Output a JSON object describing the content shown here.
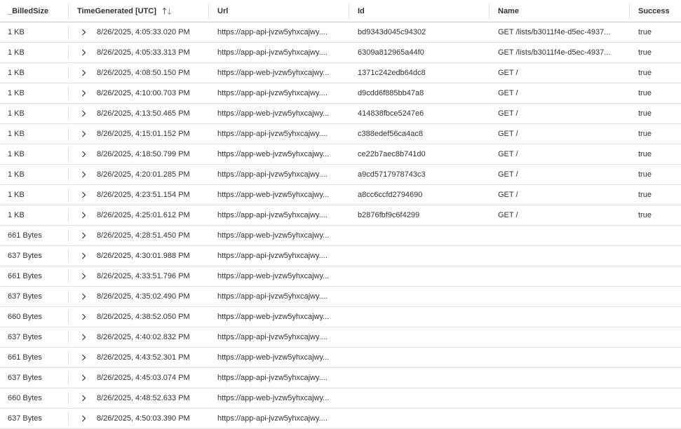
{
  "columns": [
    "_BilledSize",
    "TimeGenerated [UTC]",
    "Url",
    "Id",
    "Name",
    "Success"
  ],
  "rows": [
    {
      "size": "1 KB",
      "time": "8/26/2025, 4:05:33.020 PM",
      "url": "https://app-api-jvzw5yhxcajwy....",
      "id": "bd9343d045c94302",
      "name": "GET /lists/b3011f4e-d5ec-4937...",
      "success": "true"
    },
    {
      "size": "1 KB",
      "time": "8/26/2025, 4:05:33.313 PM",
      "url": "https://app-api-jvzw5yhxcajwy....",
      "id": "6309a812965a44f0",
      "name": "GET /lists/b3011f4e-d5ec-4937...",
      "success": "true"
    },
    {
      "size": "1 KB",
      "time": "8/26/2025, 4:08:50.150 PM",
      "url": "https://app-web-jvzw5yhxcajwy...",
      "id": "1371c242edb64dc8",
      "name": "GET /",
      "success": "true"
    },
    {
      "size": "1 KB",
      "time": "8/26/2025, 4:10:00.703 PM",
      "url": "https://app-api-jvzw5yhxcajwy....",
      "id": "d9cdd6f885bb47a8",
      "name": "GET /",
      "success": "true"
    },
    {
      "size": "1 KB",
      "time": "8/26/2025, 4:13:50.465 PM",
      "url": "https://app-web-jvzw5yhxcajwy...",
      "id": "414838fbce5247e6",
      "name": "GET /",
      "success": "true"
    },
    {
      "size": "1 KB",
      "time": "8/26/2025, 4:15:01.152 PM",
      "url": "https://app-api-jvzw5yhxcajwy....",
      "id": "c388edef56ca4ac8",
      "name": "GET /",
      "success": "true"
    },
    {
      "size": "1 KB",
      "time": "8/26/2025, 4:18:50.799 PM",
      "url": "https://app-web-jvzw5yhxcajwy...",
      "id": "ce22b7aec8b741d0",
      "name": "GET /",
      "success": "true"
    },
    {
      "size": "1 KB",
      "time": "8/26/2025, 4:20:01.285 PM",
      "url": "https://app-api-jvzw5yhxcajwy....",
      "id": "a9cd5717978743c3",
      "name": "GET /",
      "success": "true"
    },
    {
      "size": "1 KB",
      "time": "8/26/2025, 4:23:51.154 PM",
      "url": "https://app-web-jvzw5yhxcajwy...",
      "id": "a8cc6ccfd2794690",
      "name": "GET /",
      "success": "true"
    },
    {
      "size": "1 KB",
      "time": "8/26/2025, 4:25:01.612 PM",
      "url": "https://app-api-jvzw5yhxcajwy....",
      "id": "b2876fbf9c6f4299",
      "name": "GET /",
      "success": "true"
    },
    {
      "size": "661 Bytes",
      "time": "8/26/2025, 4:28:51.450 PM",
      "url": "https://app-web-jvzw5yhxcajwy...",
      "id": "",
      "name": "",
      "success": ""
    },
    {
      "size": "637 Bytes",
      "time": "8/26/2025, 4:30:01.988 PM",
      "url": "https://app-api-jvzw5yhxcajwy....",
      "id": "",
      "name": "",
      "success": ""
    },
    {
      "size": "661 Bytes",
      "time": "8/26/2025, 4:33:51.796 PM",
      "url": "https://app-web-jvzw5yhxcajwy...",
      "id": "",
      "name": "",
      "success": ""
    },
    {
      "size": "637 Bytes",
      "time": "8/26/2025, 4:35:02.490 PM",
      "url": "https://app-api-jvzw5yhxcajwy....",
      "id": "",
      "name": "",
      "success": ""
    },
    {
      "size": "660 Bytes",
      "time": "8/26/2025, 4:38:52.050 PM",
      "url": "https://app-web-jvzw5yhxcajwy...",
      "id": "",
      "name": "",
      "success": ""
    },
    {
      "size": "637 Bytes",
      "time": "8/26/2025, 4:40:02.832 PM",
      "url": "https://app-api-jvzw5yhxcajwy....",
      "id": "",
      "name": "",
      "success": ""
    },
    {
      "size": "661 Bytes",
      "time": "8/26/2025, 4:43:52.301 PM",
      "url": "https://app-web-jvzw5yhxcajwy...",
      "id": "",
      "name": "",
      "success": ""
    },
    {
      "size": "637 Bytes",
      "time": "8/26/2025, 4:45:03.074 PM",
      "url": "https://app-api-jvzw5yhxcajwy....",
      "id": "",
      "name": "",
      "success": ""
    },
    {
      "size": "660 Bytes",
      "time": "8/26/2025, 4:48:52.633 PM",
      "url": "https://app-web-jvzw5yhxcajwy...",
      "id": "",
      "name": "",
      "success": ""
    },
    {
      "size": "637 Bytes",
      "time": "8/26/2025, 4:50:03.390 PM",
      "url": "https://app-api-jvzw5yhxcajwy....",
      "id": "",
      "name": "",
      "success": ""
    }
  ],
  "icons": {
    "sort": "sort-arrows-icon",
    "expand": "chevron-right-icon"
  },
  "colors": {
    "border": "#e1dfdd",
    "text": "#323130",
    "icon": "#605e5c"
  }
}
